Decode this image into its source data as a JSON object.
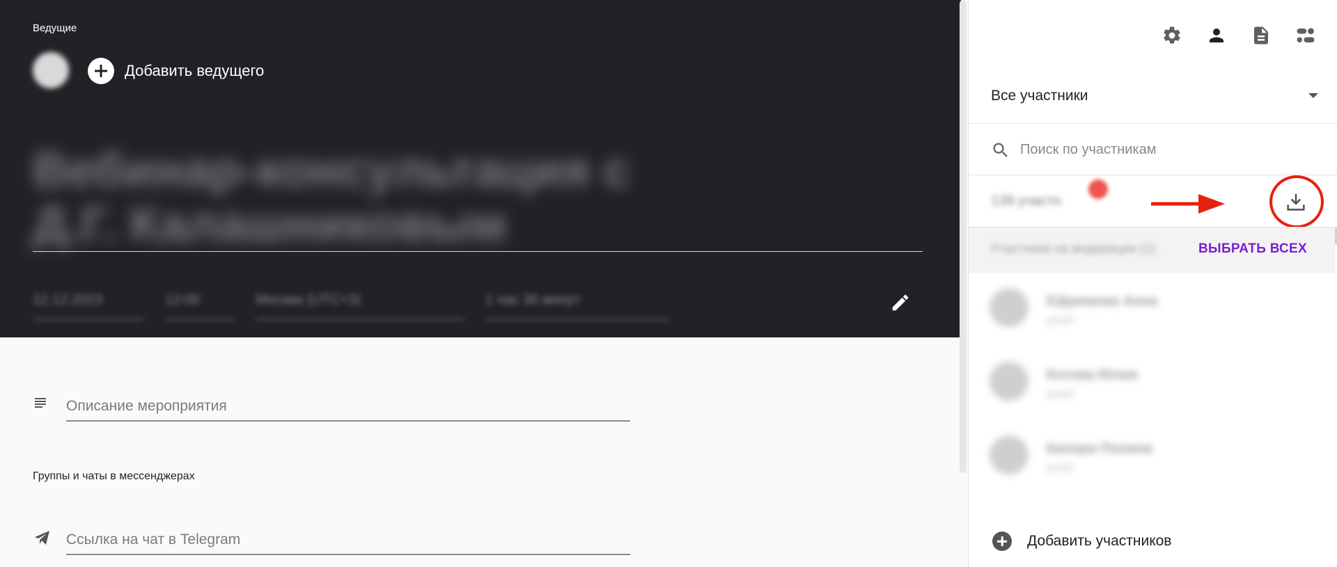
{
  "hero": {
    "hosts_label": "Ведущие",
    "add_host_label": "Добавить ведущего",
    "event_title": "Вебинар-консультация с Д.Г. Калашниковым",
    "date": "12.12.2023",
    "time": "12:00",
    "timezone": "Москва (UTC+3)",
    "duration": "1 час 30 минут"
  },
  "form": {
    "description_placeholder": "Описание мероприятия",
    "groups_label": "Группы и чаты в мессенджерах",
    "telegram_placeholder": "Ссылка на чат в Telegram"
  },
  "panel": {
    "toolbar_icons": [
      "gear-icon",
      "person-icon",
      "document-icon",
      "dashboard-icon"
    ],
    "filter_value": "Все участники",
    "search_placeholder": "Поиск по участникам",
    "participants_count": "139 участн",
    "select_row_text": "Участники на модерации (1)",
    "select_all_label": "ВЫБРАТЬ ВСЕХ",
    "participants": [
      {
        "name": "Ефремова Анна",
        "sub": "gmail"
      },
      {
        "name": "Котова Юлия",
        "sub": "gmail"
      },
      {
        "name": "Кипора Полина",
        "sub": "gmail"
      }
    ],
    "add_participants_label": "Добавить участников"
  },
  "colors": {
    "hero_bg": "#212226",
    "accent_purple": "#7a1fd1",
    "annotation_red": "#e8200f"
  }
}
